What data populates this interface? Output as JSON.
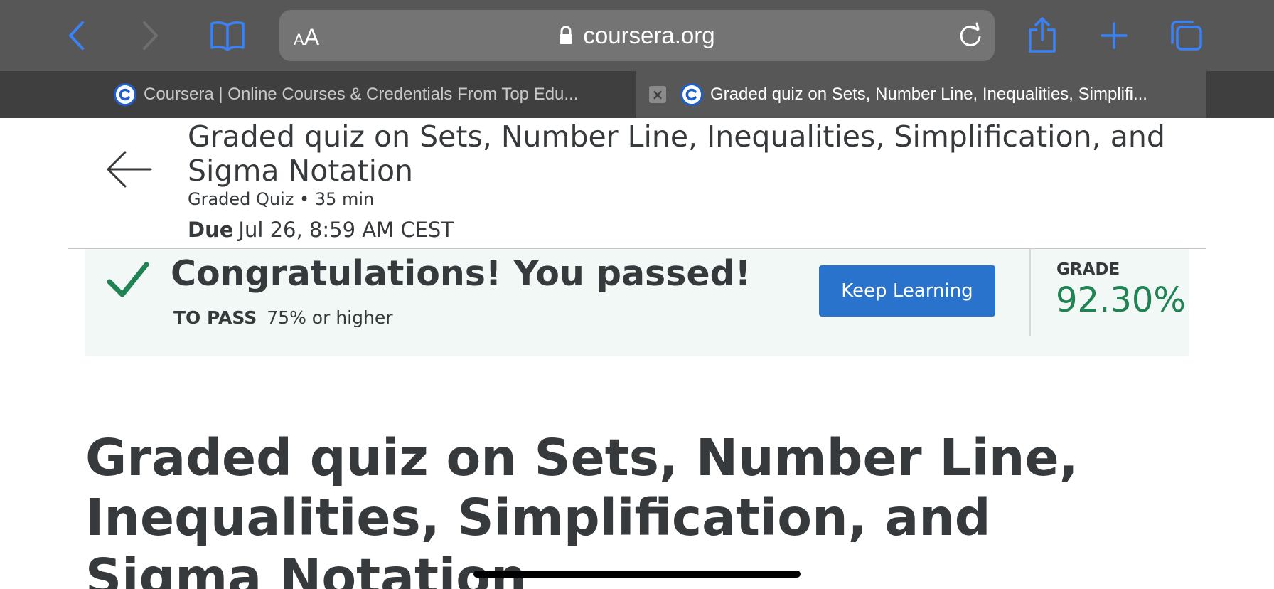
{
  "browser": {
    "url": "coursera.org",
    "text_size_label_small": "A",
    "text_size_label_large": "A",
    "accent_color": "#3b82f6",
    "tabs": [
      {
        "title": "Coursera | Online Courses & Credentials From Top Edu...",
        "active": false
      },
      {
        "title": "Graded quiz on Sets, Number Line, Inequalities, Simplifi...",
        "active": true
      }
    ],
    "tab_close_glyph": "×"
  },
  "header": {
    "title": "Graded quiz on Sets, Number Line, Inequalities, Simplification, and Sigma Notation",
    "meta": "Graded Quiz • 35 min",
    "due_label": "Due",
    "due_value": "Jul 26, 8:59 AM CEST"
  },
  "banner": {
    "message": "Congratulations! You passed!",
    "to_pass_label": "TO PASS",
    "to_pass_value": "75% or higher",
    "button_label": "Keep Learning",
    "grade_label": "GRADE",
    "grade_value": "92.30%",
    "pass_color": "#1f8354",
    "button_color": "#2a73cc"
  },
  "main": {
    "title": "Graded quiz on Sets, Number Line, Inequalities, Simplification, and Sigma Notation"
  }
}
